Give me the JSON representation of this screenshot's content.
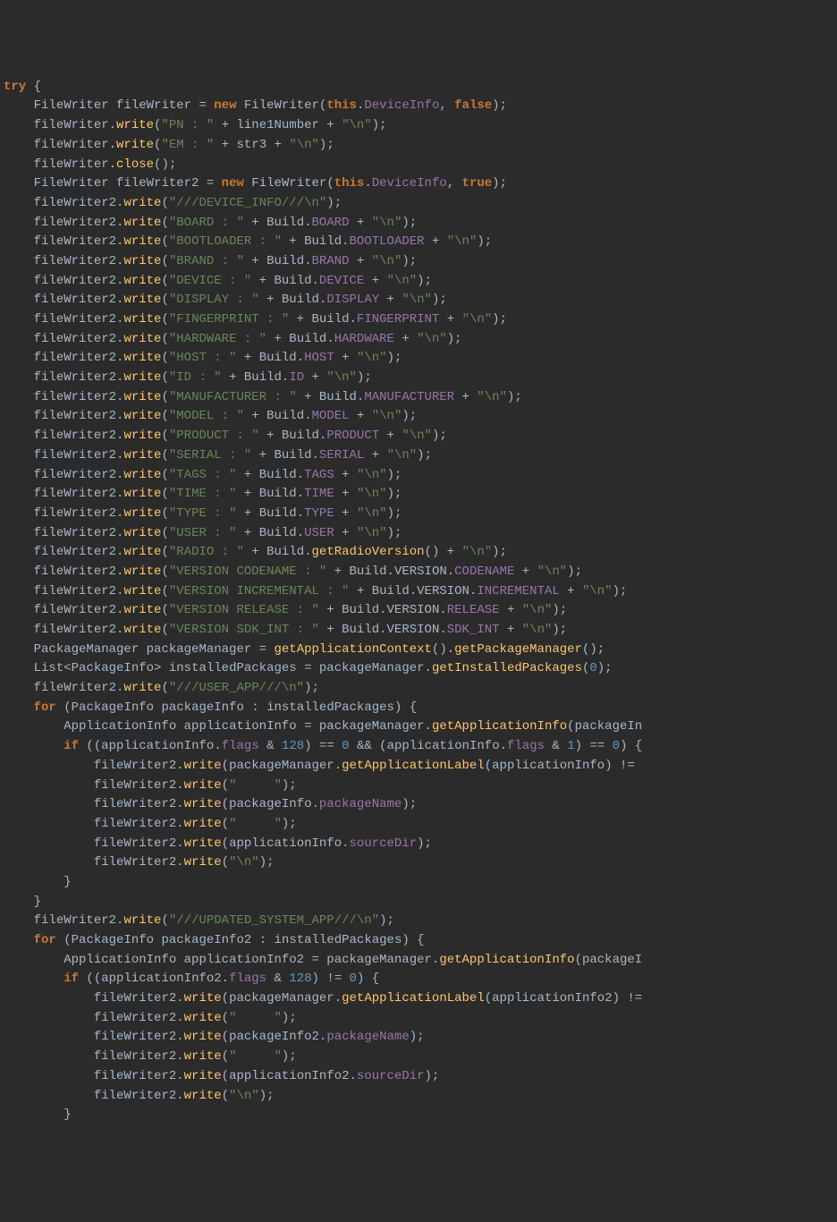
{
  "t": {
    "try": "try",
    "new": "new",
    "for": "for",
    "if": "if",
    "this": "this",
    "false": "false",
    "true": "true",
    "FileWriter": "FileWriter",
    "fileWriter": "fileWriter",
    "fileWriter2": "fileWriter2",
    "write": "write",
    "close": "close",
    "DeviceInfo": "DeviceInfo",
    "line1Number": "line1Number",
    "str3": "str3",
    "Build": "Build",
    "BOARD": "BOARD",
    "BOOTLOADER": "BOOTLOADER",
    "BRAND": "BRAND",
    "DEVICE": "DEVICE",
    "DISPLAY": "DISPLAY",
    "FINGERPRINT": "FINGERPRINT",
    "HARDWARE": "HARDWARE",
    "HOST": "HOST",
    "ID": "ID",
    "MANUFACTURER": "MANUFACTURER",
    "MODEL": "MODEL",
    "PRODUCT": "PRODUCT",
    "SERIAL": "SERIAL",
    "TAGS": "TAGS",
    "TIME": "TIME",
    "TYPE": "TYPE",
    "USER": "USER",
    "getRadioVersion": "getRadioVersion",
    "VERSION": "VERSION",
    "CODENAME": "CODENAME",
    "INCREMENTAL": "INCREMENTAL",
    "RELEASE": "RELEASE",
    "SDK_INT": "SDK_INT",
    "PackageManager": "PackageManager",
    "packageManager": "packageManager",
    "getApplicationContext": "getApplicationContext",
    "getPackageManager": "getPackageManager",
    "List": "List",
    "PackageInfo": "PackageInfo",
    "installedPackages": "installedPackages",
    "getInstalledPackages": "getInstalledPackages",
    "packageInfo": "packageInfo",
    "packageInfo2": "packageInfo2",
    "ApplicationInfo": "ApplicationInfo",
    "applicationInfo": "applicationInfo",
    "applicationInfo2": "applicationInfo2",
    "getApplicationInfo": "getApplicationInfo",
    "flags": "flags",
    "getApplicationLabel": "getApplicationLabel",
    "packageName": "packageName",
    "sourceDir": "sourceDir",
    "packageIn": "packageIn",
    "packageI": "packageI",
    "n0": "0",
    "n1": "1",
    "n128": "128"
  },
  "s": {
    "pn": "\"PN : \"",
    "em": "\"EM : \"",
    "nl": "\"\\n\"",
    "devinfo": "\"///DEVICE_INFO///\\n\"",
    "board": "\"BOARD : \"",
    "bootloader": "\"BOOTLOADER : \"",
    "brand": "\"BRAND : \"",
    "device": "\"DEVICE : \"",
    "display": "\"DISPLAY : \"",
    "fingerprint": "\"FINGERPRINT : \"",
    "hardware": "\"HARDWARE : \"",
    "host": "\"HOST : \"",
    "id": "\"ID : \"",
    "manufacturer": "\"MANUFACTURER : \"",
    "model": "\"MODEL : \"",
    "product": "\"PRODUCT : \"",
    "serial": "\"SERIAL : \"",
    "tags": "\"TAGS : \"",
    "time": "\"TIME : \"",
    "type": "\"TYPE : \"",
    "user": "\"USER : \"",
    "radio": "\"RADIO : \"",
    "vcodename": "\"VERSION CODENAME : \"",
    "vincremental": "\"VERSION INCREMENTAL : \"",
    "vrelease": "\"VERSION RELEASE : \"",
    "vsdk": "\"VERSION SDK_INT : \"",
    "userapp": "\"///USER_APP///\\n\"",
    "updatedsys": "\"///UPDATED_SYSTEM_APP///\\n\"",
    "spaces": "\"     \""
  }
}
